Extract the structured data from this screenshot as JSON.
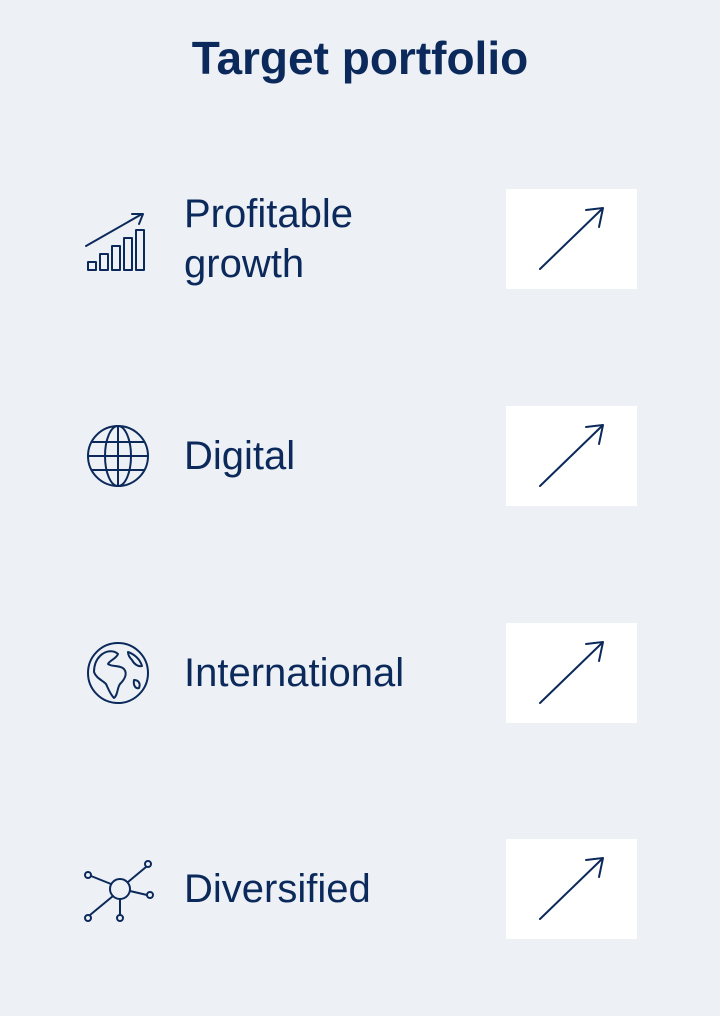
{
  "title": "Target portfolio",
  "colors": {
    "background": "#edf0f5",
    "text": "#0b2a5b",
    "box": "#ffffff"
  },
  "items": [
    {
      "label": "Profitable\ngrowth",
      "icon": "growth-chart-icon",
      "trend": "up"
    },
    {
      "label": "Digital",
      "icon": "globe-icon",
      "trend": "up"
    },
    {
      "label": "International",
      "icon": "earth-icon",
      "trend": "up"
    },
    {
      "label": "Diversified",
      "icon": "network-icon",
      "trend": "up"
    }
  ]
}
